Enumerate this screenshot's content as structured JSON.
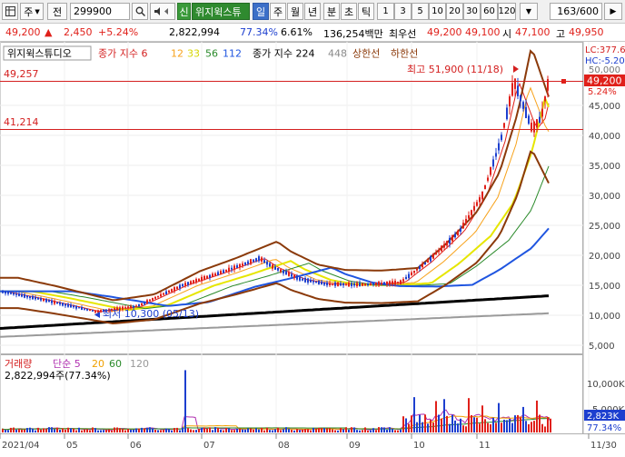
{
  "toolbar": {
    "menu_icon": "grid-icon",
    "market_label": "주",
    "prev_label": "전",
    "code_value": "299900",
    "search_icon": "search-icon",
    "sound_icon": "speaker-icon",
    "new_label": "신",
    "stock_name": "위지윅스튜",
    "period_tabs": [
      "일",
      "주",
      "월",
      "년",
      "분",
      "초",
      "틱"
    ],
    "minute_buttons": [
      "1",
      "3",
      "5",
      "10",
      "20",
      "30",
      "60",
      "120"
    ],
    "count_value": "163/600"
  },
  "info": {
    "price": "49,200",
    "arrow": "▲",
    "change": "2,450",
    "change_pct": "+5.24%",
    "volume": "2,822,994",
    "volume_ratio": "77.34%",
    "turnover": "6.61%",
    "amount": "136,254백만",
    "best_ask_label": "최우선",
    "best_ask": "49,200",
    "best_bid": "49,100",
    "open_label": "시",
    "open": "47,100",
    "high_label": "고",
    "high": "49,950"
  },
  "legend": {
    "name": "위지윅스튜디오",
    "ma_title": "종가 지수 6",
    "ma_periods": [
      "12",
      "33",
      "56",
      "112"
    ],
    "ma2_title": "종가 지수 224",
    "ma2_period": "448",
    "upper_label": "상한선",
    "lower_label": "하한선"
  },
  "annotations": {
    "high_note": "최고 51,900 (11/18)",
    "low_note": "최저 10,300 (05/13)",
    "level_top": "49,257",
    "level_mid": "41,214"
  },
  "right_panel": {
    "lc": "LC:377.6",
    "hc": "HC:-5.20",
    "hc_pct": "50,000",
    "price_tag": "49,200",
    "pct_tag": "5.24%",
    "vol_tag": "2,823K",
    "vol_pct_tag": "77.34%"
  },
  "price_axis": [
    "45,000",
    "40,000",
    "35,000",
    "30,000",
    "25,000",
    "20,000",
    "15,000",
    "10,000",
    "5,000"
  ],
  "volume_legend": {
    "title": "거래량",
    "ma_label": "단순 5",
    "periods": [
      "20",
      "60",
      "120"
    ],
    "current": "2,822,994주(77.34%)"
  },
  "volume_axis": [
    "10,000K",
    "5,000K"
  ],
  "date_axis": [
    "2021/04",
    "05",
    "06",
    "07",
    "08",
    "09",
    "10",
    "11",
    "11/30"
  ],
  "colors": {
    "up": "#e0201a",
    "down": "#1d3fcf",
    "ma6": "#e0201a",
    "ma12": "#f7a21b",
    "ma33": "#e6e600",
    "ma56": "#2a8a2a",
    "ma112": "#1f55e0",
    "ma224": "#000000",
    "ma448": "#9a9a9a",
    "envelope": "#8b3a0a"
  }
}
